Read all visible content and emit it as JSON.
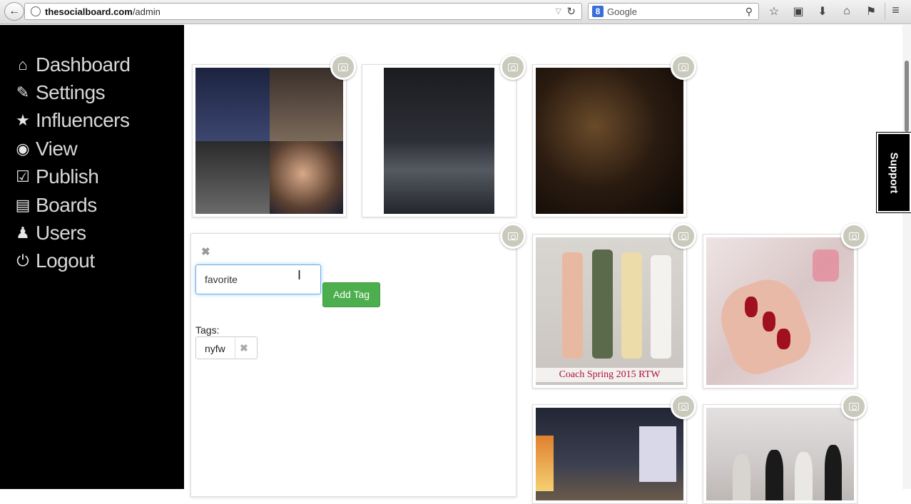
{
  "browser": {
    "url_domain": "thesocialboard.com",
    "url_path": "/admin",
    "search_engine_placeholder": "Google",
    "search_engine_badge": "8"
  },
  "sidebar": {
    "items": [
      {
        "label": "Dashboard",
        "icon": "home-icon",
        "glyph": "⌂"
      },
      {
        "label": "Settings",
        "icon": "edit-icon",
        "glyph": "✎"
      },
      {
        "label": "Influencers",
        "icon": "star-icon",
        "glyph": "★"
      },
      {
        "label": "View",
        "icon": "eye-icon",
        "glyph": "◉"
      },
      {
        "label": "Publish",
        "icon": "check-square-icon",
        "glyph": "☑"
      },
      {
        "label": "Boards",
        "icon": "list-icon",
        "glyph": "▤"
      },
      {
        "label": "Users",
        "icon": "user-icon",
        "glyph": "♟"
      },
      {
        "label": "Logout",
        "icon": "power-icon",
        "glyph": "⏻"
      }
    ]
  },
  "editor": {
    "input_value": "favorite",
    "add_tag_label": "Add Tag",
    "tags_label": "Tags:",
    "tags": [
      "nyfw"
    ]
  },
  "photos": {
    "coach_caption": "Coach Spring 2015 RTW"
  },
  "support_label": "Support",
  "colors": {
    "sidebar_bg": "#000000",
    "accent_green": "#4cae4c",
    "caption_red": "#b0103a"
  }
}
